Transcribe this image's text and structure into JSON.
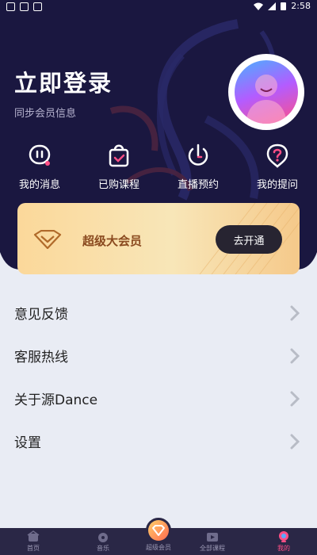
{
  "status_bar": {
    "time": "2:58"
  },
  "header": {
    "login_title": "立即登录",
    "login_subtitle": "同步会员信息"
  },
  "quick_actions": [
    {
      "label": "我的消息",
      "icon": "message-icon"
    },
    {
      "label": "已购课程",
      "icon": "shopping-bag-icon"
    },
    {
      "label": "直播预约",
      "icon": "power-clock-icon"
    },
    {
      "label": "我的提问",
      "icon": "question-icon"
    }
  ],
  "vip_card": {
    "title": "超级大会员",
    "button_label": "去开通",
    "icon": "diamond-icon"
  },
  "menu": [
    {
      "label": "意见反馈"
    },
    {
      "label": "客服热线"
    },
    {
      "label": "关于源Dance"
    },
    {
      "label": "设置"
    }
  ],
  "tab_bar": [
    {
      "label": "首页",
      "icon": "home-icon"
    },
    {
      "label": "音乐",
      "icon": "music-icon"
    },
    {
      "label": "超级会员",
      "icon": "vip-icon"
    },
    {
      "label": "全部课程",
      "icon": "course-icon"
    },
    {
      "label": "我的",
      "icon": "profile-icon"
    }
  ],
  "colors": {
    "background": "#1a1740",
    "accent": "#ff4f86",
    "vip_gold": "#fbd89a",
    "panel": "#e9ecf4"
  }
}
